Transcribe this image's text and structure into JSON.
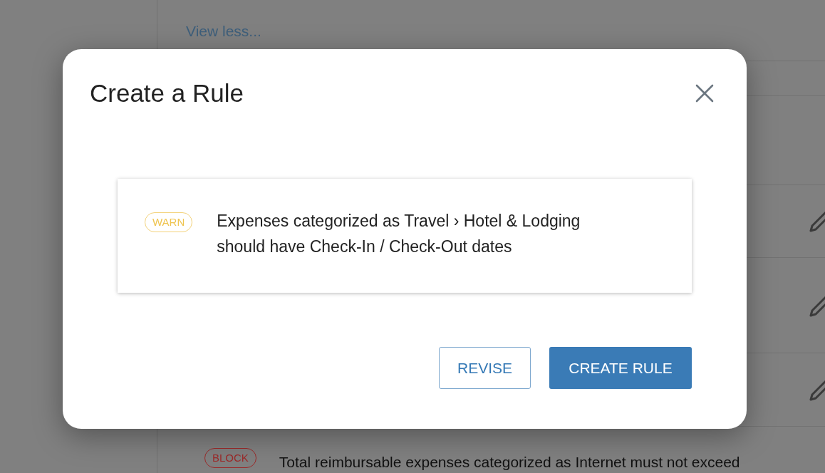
{
  "background": {
    "link": "View less...",
    "rule": {
      "kind": "block",
      "badge": "BLOCK",
      "text": "Total reimbursable expenses categorized as Internet must not exceed"
    }
  },
  "dialog": {
    "title": "Create a Rule",
    "rule": {
      "kind": "warn",
      "badge": "WARN",
      "text": "Expenses categorized as Travel › Hotel & Lodging should have Check-In / Check-Out dates"
    },
    "buttons": [
      {
        "label": "REVISE",
        "kind": "secondary"
      },
      {
        "label": "CREATE RULE",
        "kind": "primary"
      }
    ]
  }
}
